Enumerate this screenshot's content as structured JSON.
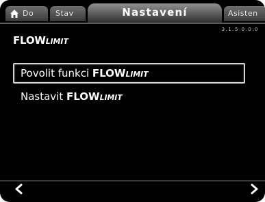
{
  "tabs": {
    "home_label": "Do",
    "stav_label": "Stav",
    "nastaveni_label": "Nastavení",
    "asistent_label": "Asisten"
  },
  "menu_code": "3.1.5.0.0.0",
  "page_title": {
    "flow": "FLOW",
    "limit": "LIMIT"
  },
  "menu_items": [
    {
      "prefix": "Povolit funkci ",
      "flow": "FLOW",
      "limit": "LIMIT",
      "selected": true
    },
    {
      "prefix": "Nastavit ",
      "flow": "FLOW",
      "limit": "LIMIT",
      "selected": false
    }
  ],
  "icons": {
    "home": "home-icon",
    "back": "chevron-left-icon",
    "forward": "chevron-right-icon"
  },
  "colors": {
    "background": "#000000",
    "text": "#ffffff",
    "selection_border": "#d8d8d8",
    "tab_active": "#909090",
    "tab_inactive": "#6e6e6e"
  }
}
